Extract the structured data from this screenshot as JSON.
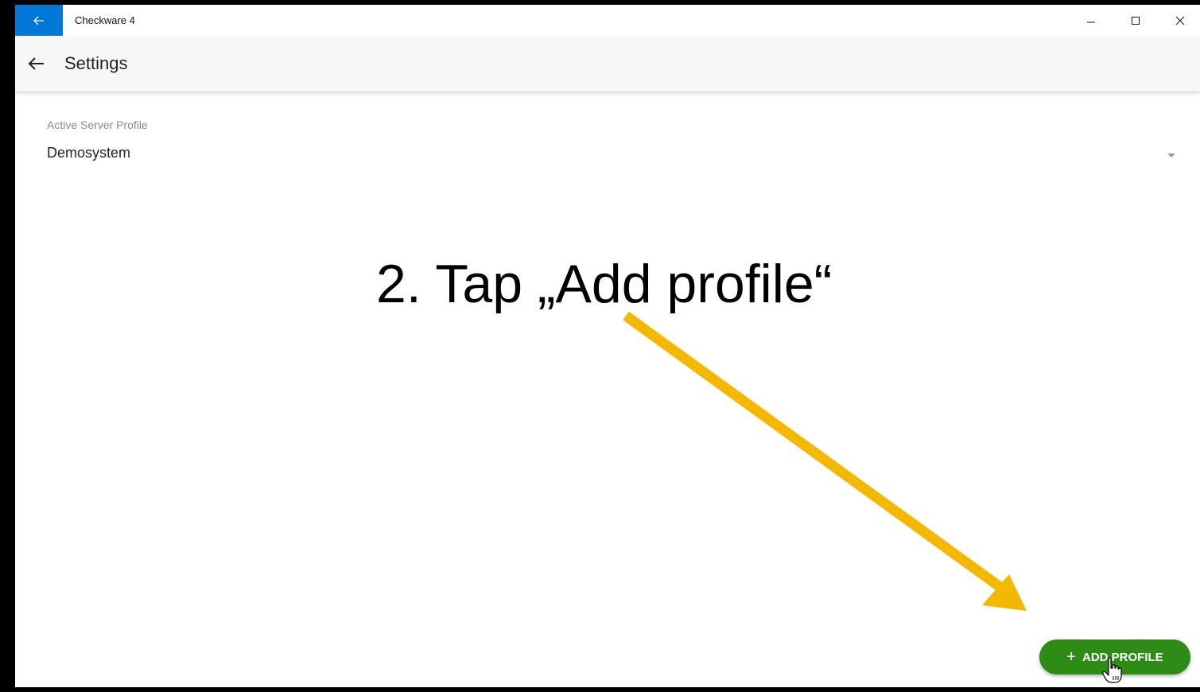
{
  "window": {
    "title": "Checkware 4",
    "accent_color": "#0078d7"
  },
  "appbar": {
    "title": "Settings"
  },
  "server_profile": {
    "label": "Active Server Profile",
    "selected_value": "Demosystem"
  },
  "instruction": {
    "text": "2. Tap „Add profile“",
    "arrow_color": "#f5b800"
  },
  "add_profile_button": {
    "icon": "plus-icon",
    "label": "ADD PROFILE",
    "color": "#2e8b16"
  }
}
